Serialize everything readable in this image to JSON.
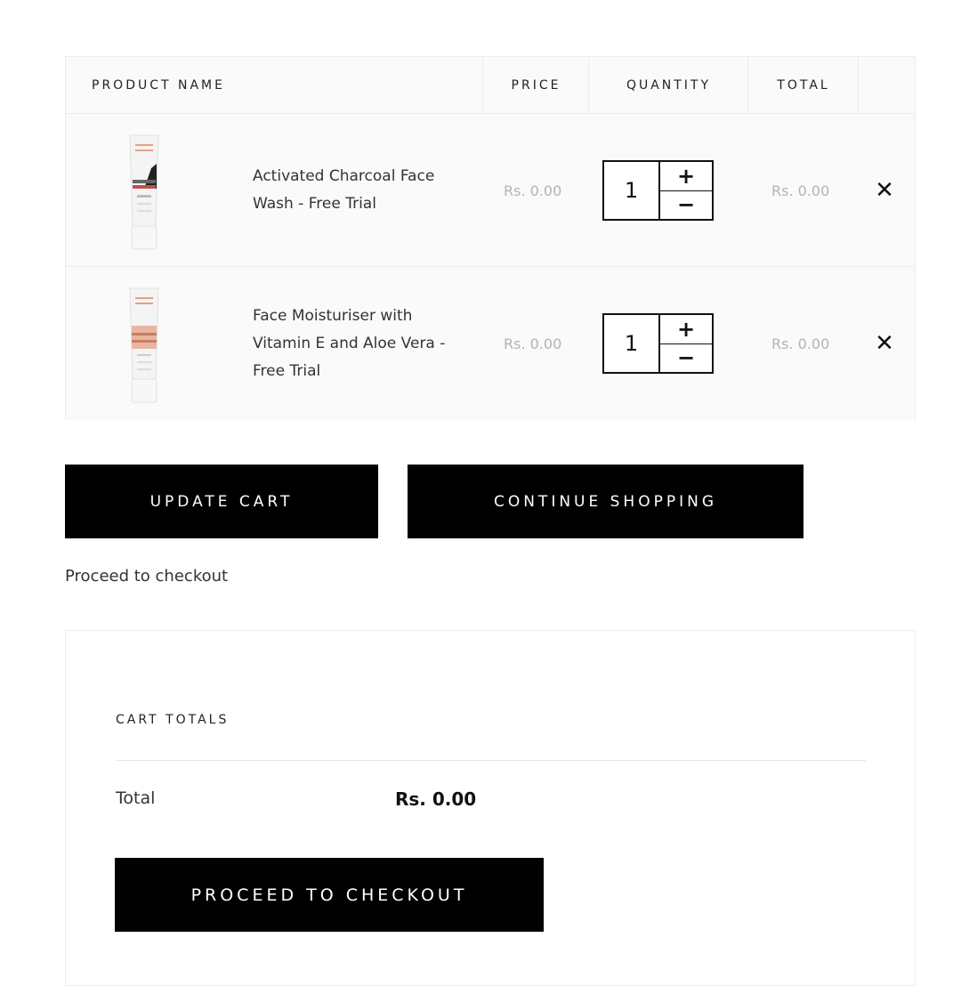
{
  "table": {
    "headers": {
      "product_name": "PRODUCT NAME",
      "price": "PRICE",
      "quantity": "QUANTITY",
      "total": "TOTAL"
    },
    "items": [
      {
        "name": "Activated Charcoal Face Wash - Free Trial",
        "price": "Rs. 0.00",
        "quantity": "1",
        "total": "Rs. 0.00",
        "image_icon": "charcoal-face-wash-tube",
        "accent": "#2b2b2b"
      },
      {
        "name": "Face Moisturiser with Vitamin E and Aloe Vera - Free Trial",
        "price": "Rs. 0.00",
        "quantity": "1",
        "total": "Rs. 0.00",
        "image_icon": "face-moisturiser-tube",
        "accent": "#d9a28c"
      }
    ],
    "qty_plus": "+",
    "qty_minus": "−",
    "remove_symbol": "✕"
  },
  "actions": {
    "update_cart": "UPDATE CART",
    "continue_shopping": "CONTINUE SHOPPING",
    "proceed_link": "Proceed to checkout"
  },
  "totals": {
    "title": "CART TOTALS",
    "total_label": "Total",
    "total_value": "Rs. 0.00",
    "checkout_button": "PROCEED TO CHECKOUT"
  },
  "colors": {
    "button_bg": "#000000",
    "muted_price": "#b3b3b3",
    "border": "#ececec"
  }
}
